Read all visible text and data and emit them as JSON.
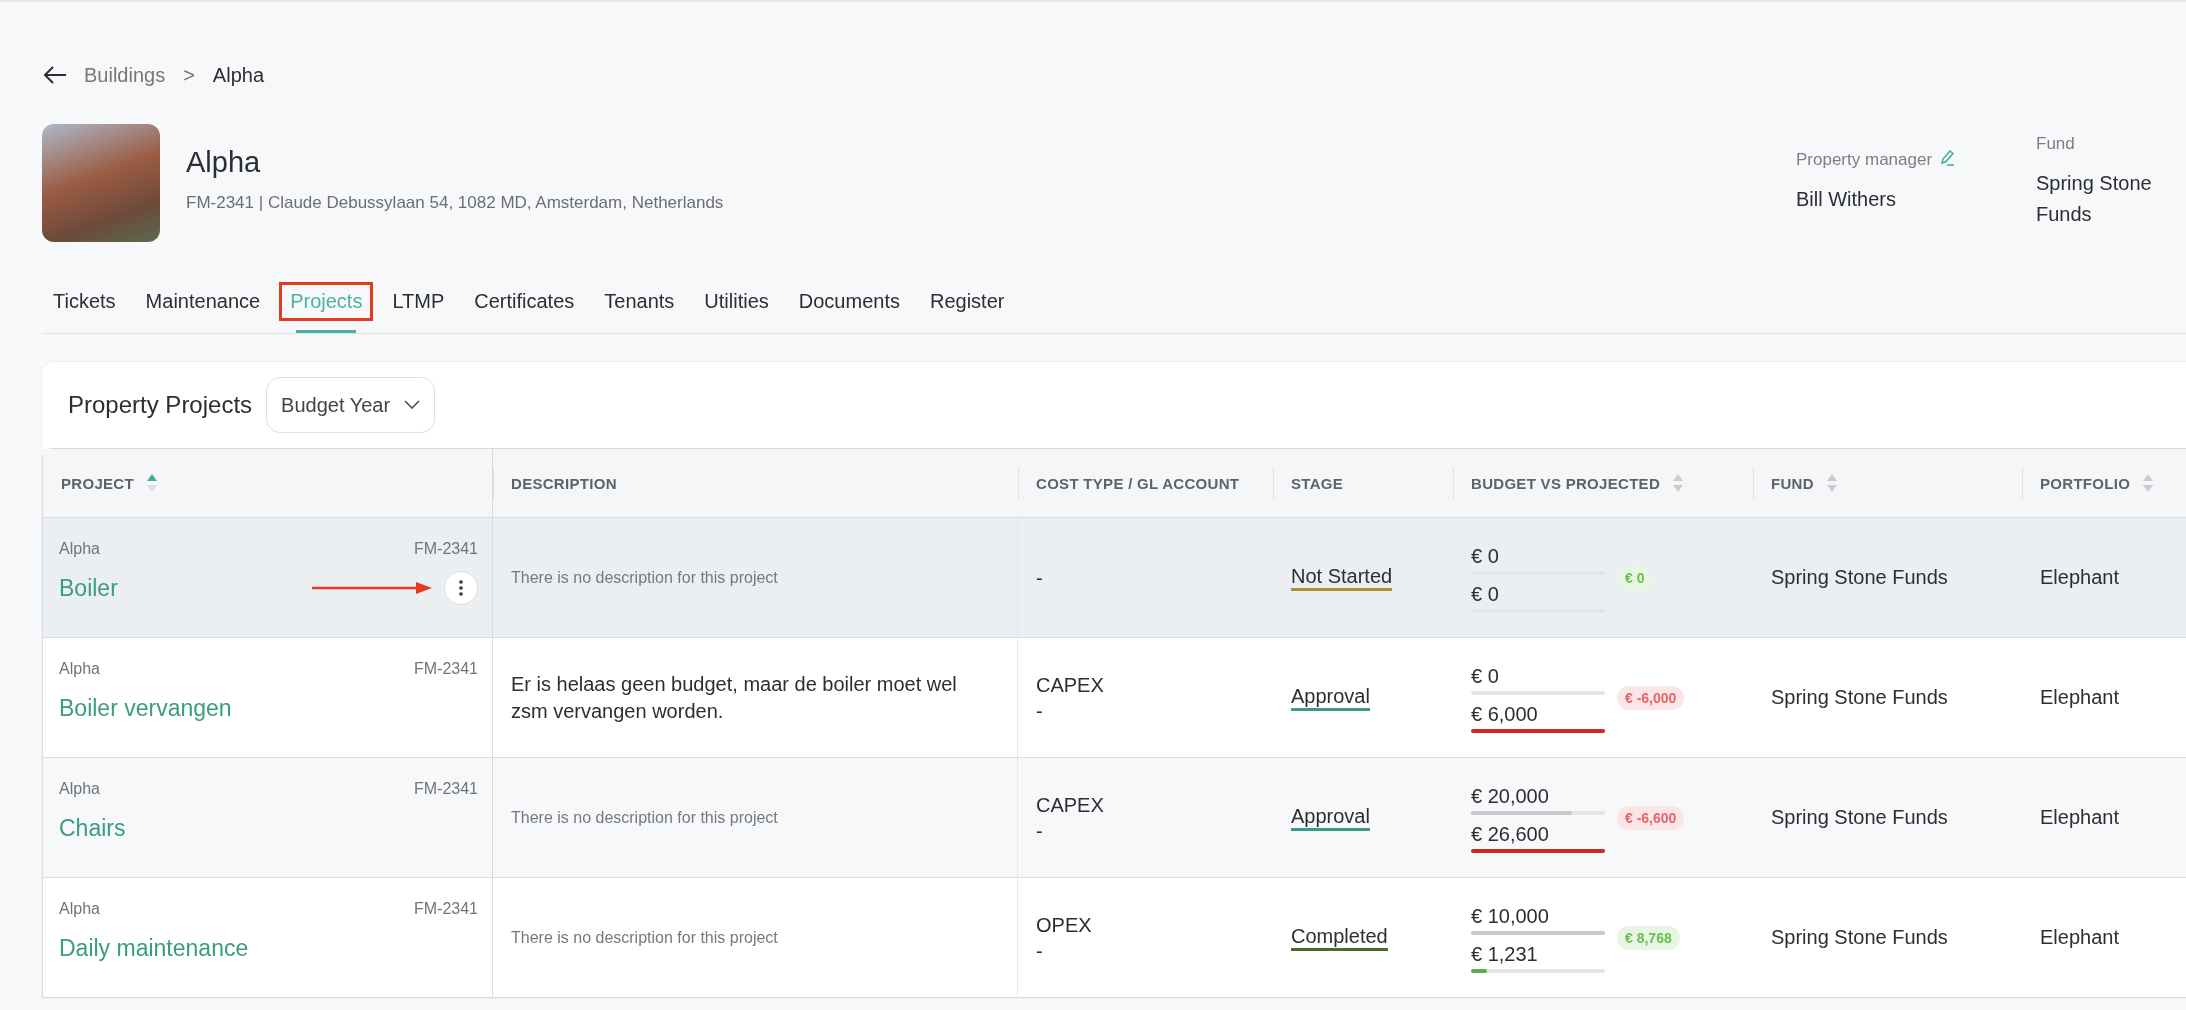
{
  "breadcrumb": {
    "parent": "Buildings",
    "separator": ">",
    "current": "Alpha"
  },
  "property": {
    "name": "Alpha",
    "subtitle": "FM-2341 | Claude Debussylaan 54, 1082 MD, Amsterdam, Netherlands",
    "manager_label": "Property manager",
    "manager": "Bill Withers",
    "fund_label": "Fund",
    "fund": "Spring Stone Funds"
  },
  "tabs": [
    {
      "label": "Tickets",
      "selected": false,
      "highlighted": false
    },
    {
      "label": "Maintenance",
      "selected": false,
      "highlighted": false
    },
    {
      "label": "Projects",
      "selected": true,
      "highlighted": true
    },
    {
      "label": "LTMP",
      "selected": false,
      "highlighted": false
    },
    {
      "label": "Certificates",
      "selected": false,
      "highlighted": false
    },
    {
      "label": "Tenants",
      "selected": false,
      "highlighted": false
    },
    {
      "label": "Utilities",
      "selected": false,
      "highlighted": false
    },
    {
      "label": "Documents",
      "selected": false,
      "highlighted": false
    },
    {
      "label": "Register",
      "selected": false,
      "highlighted": false
    }
  ],
  "projects": {
    "title": "Property Projects",
    "filter": "Budget Year",
    "columns": [
      {
        "label": "PROJECT",
        "sortable": true,
        "sorted": true
      },
      {
        "label": "DESCRIPTION",
        "sortable": false
      },
      {
        "label": "COST TYPE / GL ACCOUNT",
        "sortable": false
      },
      {
        "label": "STAGE",
        "sortable": false
      },
      {
        "label": "BUDGET VS PROJECTED",
        "sortable": true,
        "sorted": false
      },
      {
        "label": "FUND",
        "sortable": true,
        "sorted": false
      },
      {
        "label": "PORTFOLIO",
        "sortable": true,
        "sorted": false
      }
    ],
    "rows": [
      {
        "selected": true,
        "building": "Alpha",
        "code": "FM-2341",
        "name": "Boiler",
        "pointer_arrow": true,
        "description": "There is no description for this project",
        "description_placeholder": true,
        "cost": [
          "-"
        ],
        "stage": {
          "label": "Not Started",
          "color": "#a39431"
        },
        "budget": {
          "text": "€ 0",
          "level": 0
        },
        "projected": {
          "text": "€ 0",
          "level": 0
        },
        "variance": {
          "text": "€ 0",
          "color": "#6abf4b"
        },
        "fund": "Spring Stone Funds",
        "portfolio": "Elephant"
      },
      {
        "selected": false,
        "building": "Alpha",
        "code": "FM-2341",
        "name": "Boiler vervangen",
        "pointer_arrow": false,
        "description": "Er is helaas geen budget, maar de boiler moet wel zsm vervangen worden.",
        "description_placeholder": false,
        "cost": [
          "CAPEX",
          "-"
        ],
        "stage": {
          "label": "Approval",
          "color": "#3d9a8b"
        },
        "budget": {
          "text": "€ 0",
          "level": 0
        },
        "projected": {
          "text": "€ 6,000",
          "level": 1
        },
        "variance": {
          "text": "€ -6,000",
          "color": "#e5646a"
        },
        "fund": "Spring Stone Funds",
        "portfolio": "Elephant"
      },
      {
        "selected": false,
        "building": "Alpha",
        "code": "FM-2341",
        "name": "Chairs",
        "pointer_arrow": false,
        "description": "There is no description for this project",
        "description_placeholder": true,
        "cost": [
          "CAPEX",
          "-"
        ],
        "stage": {
          "label": "Approval",
          "color": "#3d9a8b"
        },
        "budget": {
          "text": "€ 20,000",
          "level": 0.75
        },
        "projected": {
          "text": "€ 26,600",
          "level": 1
        },
        "variance": {
          "text": "€ -6,600",
          "color": "#e5646a"
        },
        "fund": "Spring Stone Funds",
        "portfolio": "Elephant"
      },
      {
        "selected": false,
        "building": "Alpha",
        "code": "FM-2341",
        "name": "Daily maintenance",
        "pointer_arrow": false,
        "description": "There is no description for this project",
        "description_placeholder": true,
        "cost": [
          "OPEX",
          "-"
        ],
        "stage": {
          "label": "Completed",
          "color": "#4a6b2e"
        },
        "budget": {
          "text": "€ 10,000",
          "level": 1
        },
        "projected": {
          "text": "€ 1,231",
          "level": 0.12
        },
        "variance": {
          "text": "€ 8,768",
          "color": "#6abf4b"
        },
        "fund": "Spring Stone Funds",
        "portfolio": "Elephant"
      }
    ]
  }
}
